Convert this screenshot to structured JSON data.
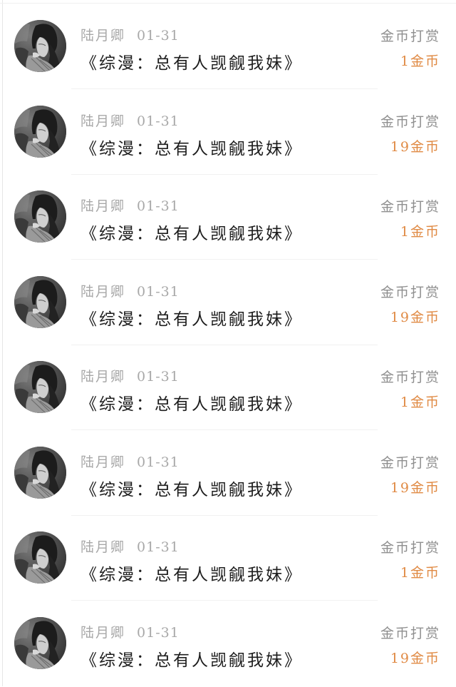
{
  "rewards": [
    {
      "user": "陆月卿",
      "date": "01-31",
      "book": "《综漫：总有人觊觎我妹》",
      "tip_label": "金币打赏",
      "amount": "1金币"
    },
    {
      "user": "陆月卿",
      "date": "01-31",
      "book": "《综漫：总有人觊觎我妹》",
      "tip_label": "金币打赏",
      "amount": "19金币"
    },
    {
      "user": "陆月卿",
      "date": "01-31",
      "book": "《综漫：总有人觊觎我妹》",
      "tip_label": "金币打赏",
      "amount": "1金币"
    },
    {
      "user": "陆月卿",
      "date": "01-31",
      "book": "《综漫：总有人觊觎我妹》",
      "tip_label": "金币打赏",
      "amount": "19金币"
    },
    {
      "user": "陆月卿",
      "date": "01-31",
      "book": "《综漫：总有人觊觎我妹》",
      "tip_label": "金币打赏",
      "amount": "1金币"
    },
    {
      "user": "陆月卿",
      "date": "01-31",
      "book": "《综漫：总有人觊觎我妹》",
      "tip_label": "金币打赏",
      "amount": "19金币"
    },
    {
      "user": "陆月卿",
      "date": "01-31",
      "book": "《综漫：总有人觊觎我妹》",
      "tip_label": "金币打赏",
      "amount": "1金币"
    },
    {
      "user": "陆月卿",
      "date": "01-31",
      "book": "《综漫：总有人觊觎我妹》",
      "tip_label": "金币打赏",
      "amount": "19金币"
    }
  ],
  "colors": {
    "amount": "#e08a44",
    "tip_label": "#8f8f8f",
    "meta": "#a8a8a8",
    "title": "#1d1d1d"
  },
  "icons": {
    "avatar": "user-avatar-photo"
  }
}
